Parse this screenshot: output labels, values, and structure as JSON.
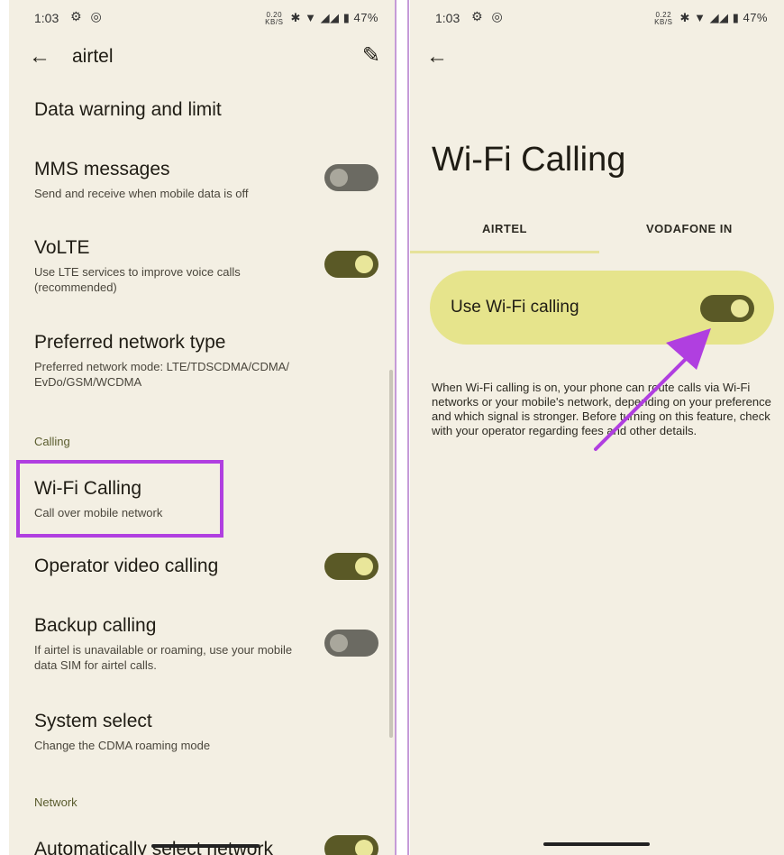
{
  "left": {
    "status": {
      "time": "1:03",
      "speed_top": "0.20",
      "speed_bottom": "KB/S",
      "battery": "47%"
    },
    "header": {
      "title": "airtel"
    },
    "items": [
      {
        "title": "Data warning and limit"
      },
      {
        "title": "MMS messages",
        "subtitle": "Send and receive when mobile data is off",
        "toggle": "off"
      },
      {
        "title": "VoLTE",
        "subtitle": "Use LTE services to improve voice calls (recommended)",
        "toggle": "on"
      },
      {
        "title": "Preferred network type",
        "subtitle": "Preferred network mode: LTE/TDSCDMA/CDMA/ EvDo/GSM/WCDMA"
      },
      {
        "title": "Wi-Fi Calling",
        "subtitle": "Call over mobile network"
      },
      {
        "title": "Operator video calling",
        "toggle": "on"
      },
      {
        "title": "Backup calling",
        "subtitle": "If airtel is unavailable or roaming, use your mobile data SIM for airtel calls.",
        "toggle": "off"
      },
      {
        "title": "System select",
        "subtitle": "Change the CDMA roaming mode"
      },
      {
        "title": "Automatically select network",
        "toggle": "on"
      }
    ],
    "sections": {
      "calling": "Calling",
      "network": "Network"
    }
  },
  "right": {
    "status": {
      "time": "1:03",
      "speed_top": "0.22",
      "speed_bottom": "KB/S",
      "battery": "47%"
    },
    "title": "Wi-Fi Calling",
    "tabs": [
      {
        "label": "AIRTEL",
        "selected": true
      },
      {
        "label": "VODAFONE IN",
        "selected": false
      }
    ],
    "wifi_calling": {
      "label": "Use Wi-Fi calling",
      "enabled": true
    },
    "description": "When Wi-Fi calling is on, your phone can route calls via Wi-Fi networks or your mobile's network, depending on your preference and which signal is stronger. Before turning on this feature, check with your operator regarding fees and other details."
  },
  "colors": {
    "background": "#f3efe3",
    "toggle_on": "#5a5926",
    "toggle_off": "#6b6a62",
    "card": "#e6e48c",
    "annotation": "#b03fe0"
  }
}
